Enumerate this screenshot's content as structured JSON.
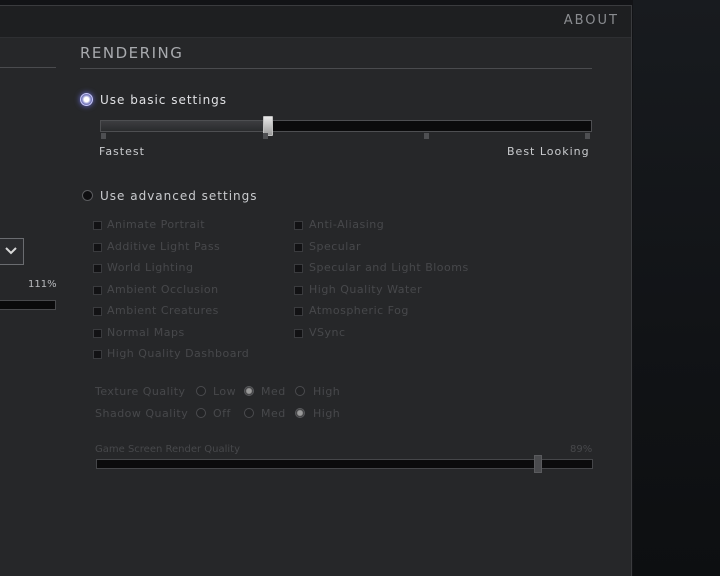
{
  "header": {
    "about_label": "ABOUT"
  },
  "left_panel": {
    "percent": "111%"
  },
  "rendering": {
    "title": "RENDERING",
    "basic_option": "Use basic settings",
    "advanced_option": "Use advanced settings",
    "quality_slider": {
      "min_label": "Fastest",
      "max_label": "Best Looking",
      "value_fraction": 0.34
    },
    "checkboxes_left": [
      "Animate Portrait",
      "Additive Light Pass",
      "World Lighting",
      "Ambient Occlusion",
      "Ambient Creatures",
      "Normal Maps",
      "High Quality Dashboard"
    ],
    "checkboxes_right": [
      "Anti-Aliasing",
      "Specular",
      "Specular and Light Blooms",
      "High Quality Water",
      "Atmospheric Fog",
      "VSync"
    ],
    "texture_quality": {
      "label": "Texture Quality",
      "options": [
        "Low",
        "Med",
        "High"
      ],
      "selected": "Med"
    },
    "shadow_quality": {
      "label": "Shadow Quality",
      "options": [
        "Off",
        "Med",
        "High"
      ],
      "selected": "High"
    },
    "screen_render": {
      "label": "Game Screen Render Quality",
      "percent": "89%",
      "value_fraction": 0.89
    }
  },
  "colors": {
    "panel": "#262729",
    "accent_radio": "#8a8dcc",
    "disabled_text": "#47484b"
  }
}
